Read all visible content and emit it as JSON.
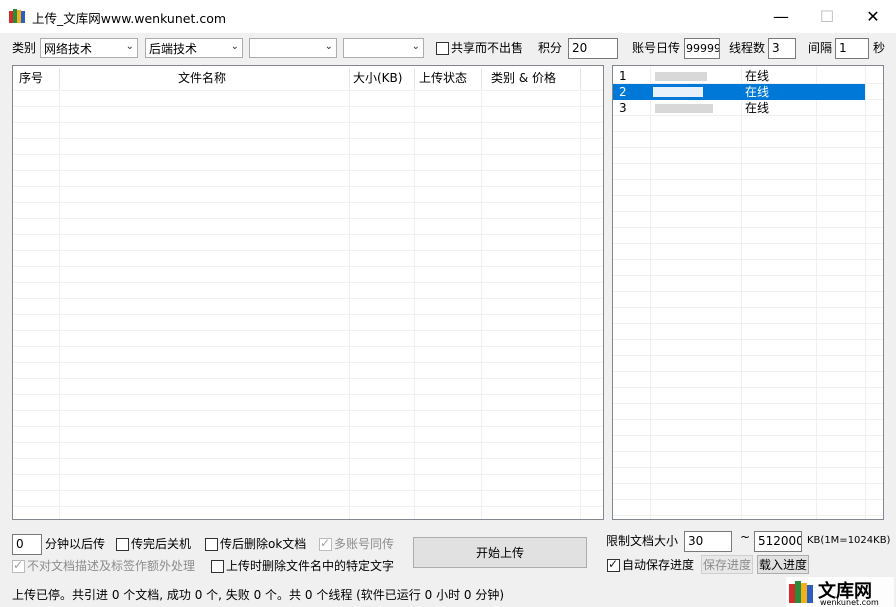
{
  "window": {
    "title": "上传_文库网www.wenkunet.com",
    "minimize_glyph": "—",
    "maximize_glyph": "☐",
    "close_glyph": "✕"
  },
  "toolbar": {
    "category_label": "类别",
    "category1": "网络技术",
    "category2": "后端技术",
    "category3": "",
    "category4": "",
    "share_not_sell_label": "共享而不出售",
    "points_label": "积分",
    "points_value": "20",
    "daily_upload_label": "账号日传",
    "daily_upload_value": "99999",
    "threads_label": "线程数",
    "threads_value": "3",
    "interval_label": "间隔",
    "interval_value": "1",
    "interval_unit": "秒"
  },
  "file_table": {
    "columns": [
      "序号",
      "文件名称",
      "大小(KB)",
      "上传状态",
      "类别 & 价格"
    ],
    "rows": []
  },
  "account_list": {
    "rows": [
      {
        "index": "1",
        "status": "在线",
        "selected": false
      },
      {
        "index": "2",
        "status": "在线",
        "selected": true
      },
      {
        "index": "3",
        "status": "在线",
        "selected": false
      }
    ]
  },
  "options": {
    "delay_minutes_value": "0",
    "delay_label": "分钟以后传",
    "shutdown_label": "传完后关机",
    "delete_ok_label": "传后删除ok文档",
    "multi_account_label": "多账号同传",
    "no_extra_process_label": "不对文档描述及标签作额外处理",
    "remove_text_label": "上传时删除文件名中的特定文字",
    "start_button": "开始上传",
    "limit_size_label": "限制文档大小",
    "limit_min_value": "30",
    "tilde": "~",
    "limit_max_value": "512000",
    "kb_note": "KB(1M=1024KB)",
    "auto_save_label": "自动保存进度",
    "save_progress_button": "保存进度",
    "load_progress_button": "载入进度"
  },
  "status_bar": {
    "text": "上传已停。共引进 0 个文档, 成功 0 个, 失败 0 个。共 0 个线程 (软件已运行 0 小时 0 分钟)"
  },
  "watermark": {
    "name": "文库网",
    "url": "wenkunet.com"
  }
}
